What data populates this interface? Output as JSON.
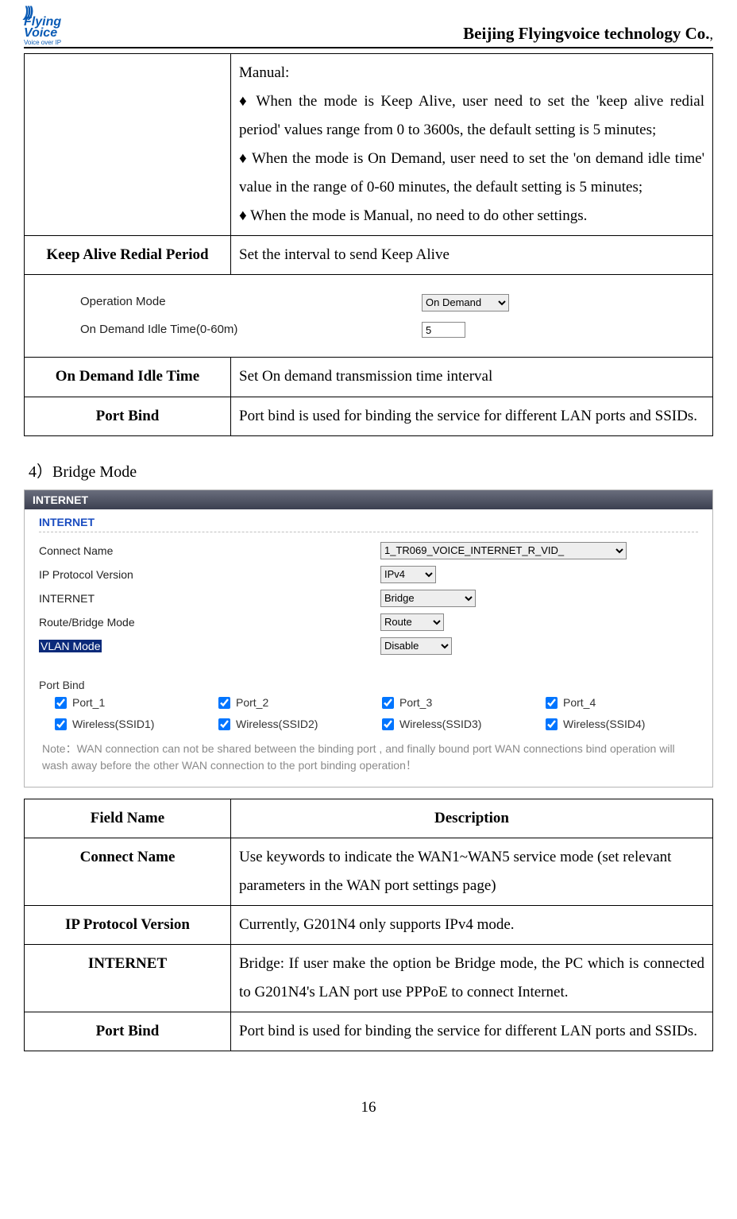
{
  "header": {
    "logo_top": "Flying",
    "logo_bottom": "Voice",
    "logo_tag": "Voice over IP",
    "company": "Beijing Flyingvoice technology Co.",
    "company_suffix": ","
  },
  "table1": {
    "row0": {
      "heading": "Manual:",
      "b1": "♦ When the mode is Keep Alive, user need to set the 'keep alive redial period' values range from 0 to 3600s, the default setting is 5 minutes;",
      "b2": "♦ When the mode is On Demand, user need to set the 'on demand idle time' value in the range of 0-60 minutes, the default setting is 5 minutes;",
      "b3": "♦ When the mode is Manual, no need to do other settings."
    },
    "row1": {
      "field": "Keep Alive Redial Period",
      "desc": "Set the interval to send Keep Alive"
    },
    "embedded": {
      "op_label": "Operation Mode",
      "op_value": "On Demand",
      "idle_label": "On Demand Idle Time(0-60m)",
      "idle_value": "5"
    },
    "row2": {
      "field": "On Demand Idle Time",
      "desc": "Set On demand transmission time interval"
    },
    "row3": {
      "field": "Port Bind",
      "desc": "Port bind is used for binding the service for different LAN ports and SSIDs."
    }
  },
  "section_title": "4）Bridge Mode",
  "panel": {
    "title": "INTERNET",
    "subhead": "INTERNET",
    "fields": {
      "connect_name": {
        "label": "Connect Name",
        "value": "1_TR069_VOICE_INTERNET_R_VID_"
      },
      "ip_proto": {
        "label": "IP Protocol Version",
        "value": "IPv4"
      },
      "internet": {
        "label": "INTERNET",
        "value": "Bridge"
      },
      "route": {
        "label": "Route/Bridge Mode",
        "value": "Route"
      },
      "vlan": {
        "label": "VLAN Mode",
        "value": "Disable"
      }
    },
    "portbind_label": "Port Bind",
    "ports": [
      {
        "label": "Port_1",
        "checked": true
      },
      {
        "label": "Port_2",
        "checked": true
      },
      {
        "label": "Port_3",
        "checked": true
      },
      {
        "label": "Port_4",
        "checked": true
      },
      {
        "label": "Wireless(SSID1)",
        "checked": true
      },
      {
        "label": "Wireless(SSID2)",
        "checked": true
      },
      {
        "label": "Wireless(SSID3)",
        "checked": true
      },
      {
        "label": "Wireless(SSID4)",
        "checked": true
      }
    ],
    "note": "Note：WAN connection can not be shared between the binding port , and finally bound port WAN connections bind operation will wash away before the other WAN connection to the port binding operation！"
  },
  "table2": {
    "head": {
      "c0": "Field Name",
      "c1": "Description"
    },
    "rows": [
      {
        "field": "Connect Name",
        "desc": "Use keywords to indicate the WAN1~WAN5 service mode (set relevant parameters in the WAN port settings page)"
      },
      {
        "field": "IP Protocol Version",
        "desc": "Currently, G201N4 only supports IPv4 mode."
      },
      {
        "field": "INTERNET",
        "desc": "Bridge: If user make the option be Bridge mode, the PC which is connected to G201N4's LAN port use PPPoE to connect Internet."
      },
      {
        "field": "Port Bind",
        "desc": "Port bind is used for binding the service for different LAN ports and SSIDs."
      }
    ]
  },
  "page_number": "16"
}
